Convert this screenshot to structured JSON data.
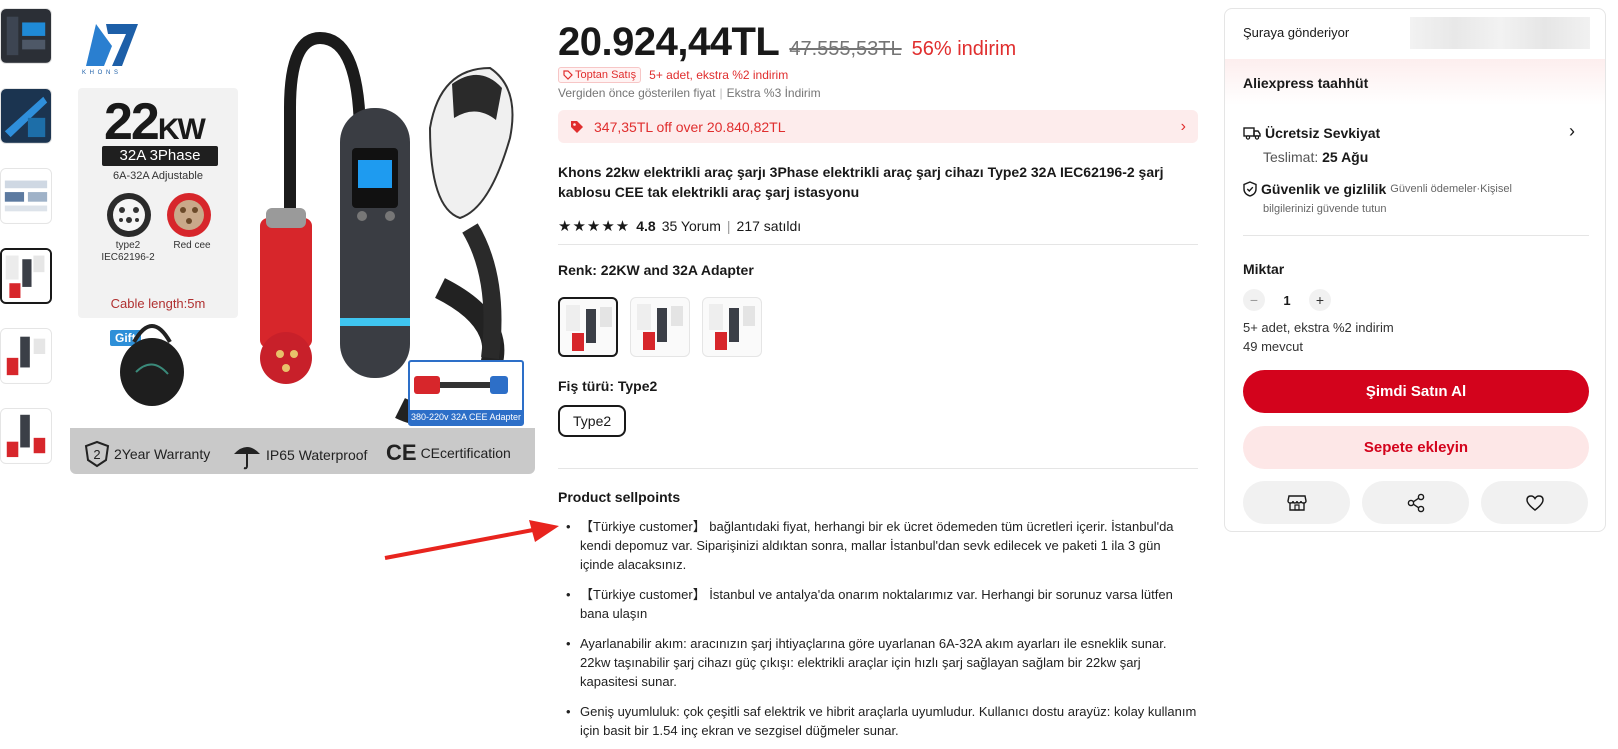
{
  "thumbnails": [
    {
      "name": "thumb-1"
    },
    {
      "name": "thumb-2"
    },
    {
      "name": "thumb-3"
    },
    {
      "name": "thumb-4"
    },
    {
      "name": "thumb-5"
    },
    {
      "name": "thumb-6"
    }
  ],
  "main_image": {
    "logo_text": "K H O N S",
    "power": "22",
    "power_unit": "KW",
    "phase": "32A 3Phase",
    "adjustable": "6A-32A Adjustable",
    "plug1_label": "type2",
    "plug1_sub": "IEC62196-2",
    "plug2_label": "Red cee",
    "cable": "Cable length:5m",
    "gift": "Gift",
    "adapter_label": "380-220v 32A CEE Adapter",
    "warranty_num": "2",
    "warranty": "2Year Warranty",
    "waterproof": "IP65 Waterproof",
    "ce_mark": "CE",
    "ce": "CEcertification"
  },
  "price": {
    "current": "20.924,44TL",
    "original": "47.555,53TL",
    "discount": "56% indirim"
  },
  "wholesale": {
    "badge": "Toptan Satış",
    "extra": "5+ adet, ekstra %2 indirim"
  },
  "meta": {
    "tax_note": "Vergiden önce gösterilen fiyat",
    "extra_discount": "Ekstra %3 İndirim"
  },
  "coupon": {
    "text": "347,35TL off over 20.840,82TL"
  },
  "product_title": "Khons 22kw elektrikli araç şarjı 3Phase elektrikli araç şarj cihazı Type2 32A IEC62196-2 şarj kablosu CEE tak elektrikli araç şarj istasyonu",
  "rating": {
    "stars": "★★★★★",
    "score": "4.8",
    "reviews": "35 Yorum",
    "separator": "|",
    "sold": "217 satıldı"
  },
  "color": {
    "label": "Renk: 22KW and 32A Adapter",
    "options": [
      {
        "selected": true
      },
      {
        "selected": false
      },
      {
        "selected": false
      }
    ]
  },
  "plug_type": {
    "label": "Fiş türü: Type2",
    "option": "Type2"
  },
  "sellpoints": {
    "title": "Product sellpoints",
    "items": [
      "【Türkiye customer】 bağlantıdaki fiyat, herhangi bir ek ücret ödemeden tüm ücretleri içerir. İstanbul'da kendi depomuz var. Siparişinizi aldıktan sonra, mallar İstanbul'dan sevk edilecek ve paketi 1 ila 3 gün içinde alacaksınız.",
      "【Türkiye customer】 İstanbul ve antalya'da onarım noktalarımız var. Herhangi bir sorunuz varsa lütfen bana ulaşın",
      "Ayarlanabilir akım: aracınızın şarj ihtiyaçlarına göre uyarlanan 6A-32A akım ayarları ile esneklik sunar. 22kw taşınabilir şarj cihazı güç çıkışı: elektrikli araçlar için hızlı şarj sağlayan sağlam bir 22kw şarj kapasitesi sunar.",
      "Geniş uyumluluk: çok çeşitli saf elektrik ve hibrit araçlarla uyumludur. Kullanıcı dostu arayüz: kolay kullanım için basit bir 1.54 inç ekran ve sezgisel düğmeler sunar."
    ]
  },
  "card": {
    "ship_to": "Şuraya gönderiyor",
    "commitment": "Aliexpress taahhüt",
    "free_shipping": "Ücretsiz Sevkiyat",
    "delivery_label": "Teslimat:",
    "delivery_date": "25 Ağu",
    "security": "Güvenlik ve gizlilik",
    "security_note_1": "Güvenli ödemeler·Kişisel",
    "security_note_2": "bilgilerinizi güvende tutun",
    "qty_label": "Miktar",
    "qty_value": "1",
    "minus": "−",
    "plus": "+",
    "qty_note": "5+ adet, ekstra %2 indirim",
    "stock": "49 mevcut",
    "buy_now": "Şimdi Satın Al",
    "add_cart": "Sepete ekleyin"
  },
  "colors": {
    "accent": "#d3031c",
    "discount": "#e02e2e",
    "coupon_bg": "#fdecec"
  },
  "icons": [
    "truck-icon",
    "shield-icon",
    "chevron-right-icon",
    "store-icon",
    "share-icon",
    "heart-icon",
    "tag-icon"
  ]
}
